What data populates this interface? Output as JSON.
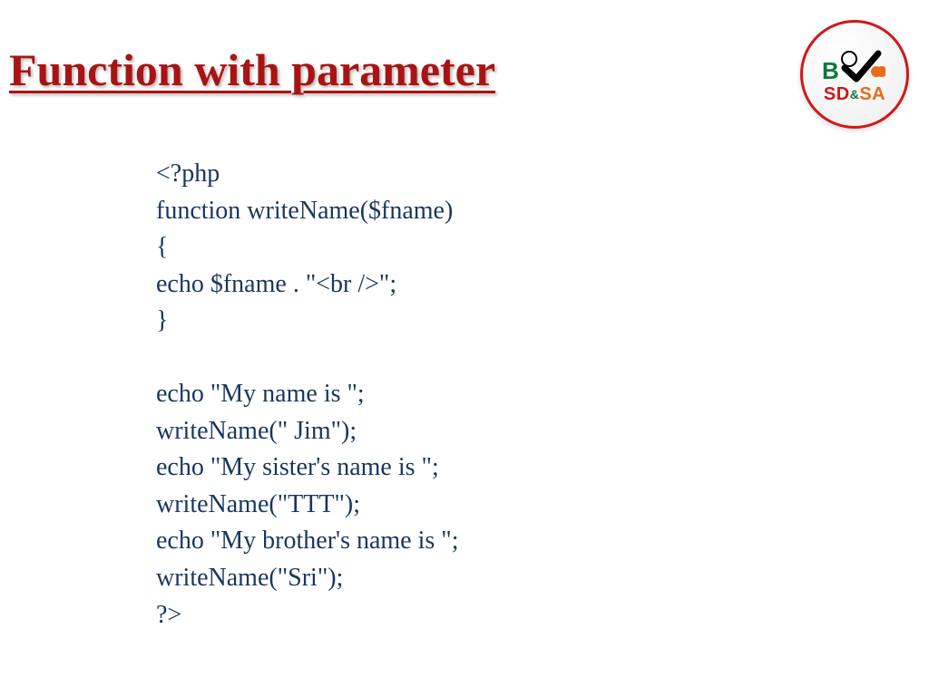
{
  "title": "Function with parameter",
  "logo": {
    "letter": "B",
    "text_sd": "SD",
    "text_amp": "&",
    "text_sa": "SA"
  },
  "code": {
    "line1": "<?php",
    "line2": "function writeName($fname)",
    "line3": "{",
    "line4": "echo $fname . \"<br />\";",
    "line5": "}",
    "line6": "echo \"My name is \";",
    "line7": "writeName(\" Jim\");",
    "line8": "echo \"My sister's name is \";",
    "line9": "writeName(\"TTT\");",
    "line10": "echo \"My brother's name is \";",
    "line11": "writeName(\"Sri\");",
    "line12": "?>"
  }
}
